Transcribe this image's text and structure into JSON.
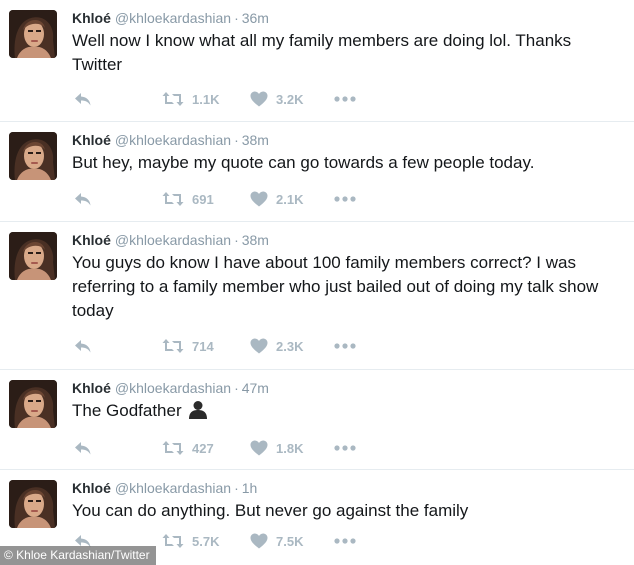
{
  "tweets": [
    {
      "name": "Khloé",
      "handle": "@khloekardashian",
      "time": "36m",
      "text": "Well now I know what all my family members are doing lol. Thanks Twitter",
      "retweets": "1.1K",
      "likes": "3.2K"
    },
    {
      "name": "Khloé",
      "handle": "@khloekardashian",
      "time": "38m",
      "text": "But hey, maybe my quote can go towards a few people today.",
      "retweets": "691",
      "likes": "2.1K"
    },
    {
      "name": "Khloé",
      "handle": "@khloekardashian",
      "time": "38m",
      "text": "You guys do know I have about 100 family members correct? I was referring to a family member who just bailed out of doing my talk show today",
      "retweets": "714",
      "likes": "2.3K"
    },
    {
      "name": "Khloé",
      "handle": "@khloekardashian",
      "time": "47m",
      "text": "The Godfather",
      "emoji": "bust-in-silhouette-icon",
      "retweets": "427",
      "likes": "1.8K"
    },
    {
      "name": "Khloé",
      "handle": "@khloekardashian",
      "time": "1h",
      "text": "You can do anything. But never go against the family",
      "retweets": "5.7K",
      "likes": "7.5K"
    }
  ],
  "separator": "·",
  "credit": "© Khloe Kardashian/Twitter",
  "colors": {
    "text": "#14171a",
    "muted": "#8899a6",
    "action": "#aab8c2",
    "divider": "#e6ecf0"
  },
  "icons": {
    "reply": "reply-icon",
    "retweet": "retweet-icon",
    "like": "heart-icon",
    "more": "more-dots-icon"
  }
}
